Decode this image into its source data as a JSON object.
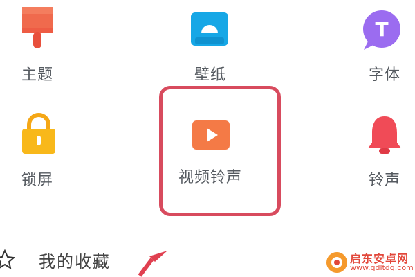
{
  "grid": {
    "items": [
      {
        "label": "主题",
        "icon": "paintbrush-icon",
        "color": "#f06a4d"
      },
      {
        "label": "壁纸",
        "icon": "wallpaper-icon",
        "color": "#16a7e6"
      },
      {
        "label": "字体",
        "icon": "font-icon",
        "color": "#9b6cf0",
        "glyph": "T"
      },
      {
        "label": "锁屏",
        "icon": "lock-icon",
        "color": "#f8b81a"
      },
      {
        "label": "视频铃声",
        "icon": "video-play-icon",
        "color": "#f47a46"
      },
      {
        "label": "铃声",
        "icon": "bell-icon",
        "color": "#f04b57"
      }
    ]
  },
  "favorites": {
    "label": "我的收藏",
    "icon": "star-icon"
  },
  "highlight_color": "#d84b5e",
  "watermark": {
    "title": "启东安卓网",
    "url": "www.qdltdq.com"
  }
}
